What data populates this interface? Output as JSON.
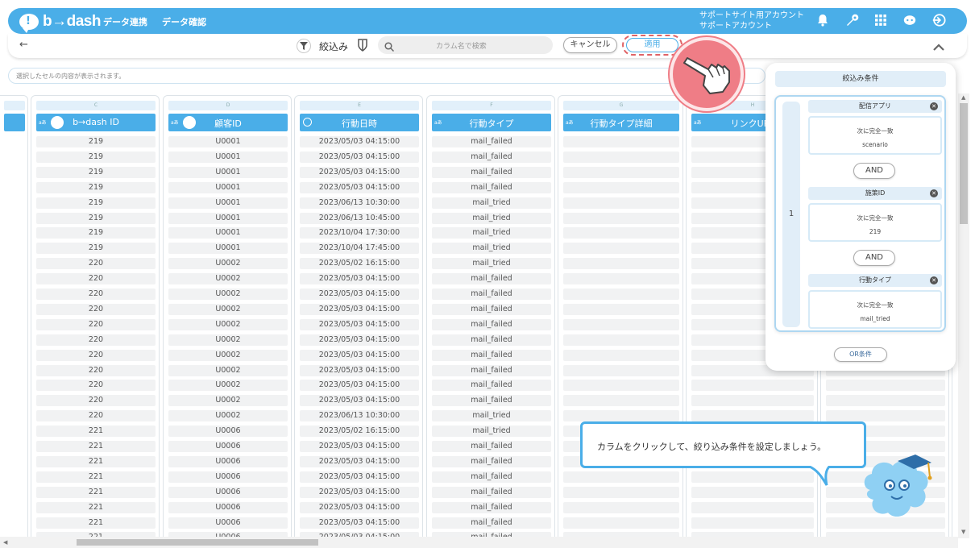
{
  "header": {
    "logo_text": "b→dash",
    "nav": [
      "データ連携",
      "データ確認"
    ],
    "account_line1": "サポートサイト用アカウント",
    "account_line2": "サポートアカウント",
    "icons": [
      "bell-icon",
      "wrench-icon",
      "grid-icon",
      "chat-icon",
      "logout-icon"
    ]
  },
  "toolbar": {
    "back_icon": "←",
    "filter_label": "絞込み",
    "search_placeholder": "カラム名で検索",
    "cancel_label": "キャンセル",
    "apply_label": "適用",
    "collapse_icon": "chevron-up-icon"
  },
  "info_bar": {
    "placeholder": "選択したセルの内容が表示されます。"
  },
  "table": {
    "columns": [
      {
        "letter": "C",
        "header": "b→dash ID",
        "type_tag": "aあ",
        "icon": "people-icon"
      },
      {
        "letter": "D",
        "header": "顧客ID",
        "type_tag": "aあ",
        "icon": "people-icon"
      },
      {
        "letter": "E",
        "header": "行動日時",
        "type_tag": "",
        "icon": "clock-icon"
      },
      {
        "letter": "F",
        "header": "行動タイプ",
        "type_tag": "aあ",
        "icon": ""
      },
      {
        "letter": "G",
        "header": "行動タイプ詳細",
        "type_tag": "aあ",
        "icon": ""
      },
      {
        "letter": "H",
        "header": "リンクURL",
        "type_tag": "aあ",
        "icon": ""
      }
    ],
    "rows": [
      [
        "219",
        "U0001",
        "2023/05/03 04:15:00",
        "mail_failed"
      ],
      [
        "219",
        "U0001",
        "2023/05/03 04:15:00",
        "mail_failed"
      ],
      [
        "219",
        "U0001",
        "2023/05/03 04:15:00",
        "mail_failed"
      ],
      [
        "219",
        "U0001",
        "2023/05/03 04:15:00",
        "mail_failed"
      ],
      [
        "219",
        "U0001",
        "2023/06/13 10:30:00",
        "mail_tried"
      ],
      [
        "219",
        "U0001",
        "2023/06/13 10:45:00",
        "mail_tried"
      ],
      [
        "219",
        "U0001",
        "2023/10/04 17:30:00",
        "mail_tried"
      ],
      [
        "219",
        "U0001",
        "2023/10/04 17:45:00",
        "mail_tried"
      ],
      [
        "220",
        "U0002",
        "2023/05/02 16:15:00",
        "mail_tried"
      ],
      [
        "220",
        "U0002",
        "2023/05/03 04:15:00",
        "mail_failed"
      ],
      [
        "220",
        "U0002",
        "2023/05/03 04:15:00",
        "mail_failed"
      ],
      [
        "220",
        "U0002",
        "2023/05/03 04:15:00",
        "mail_failed"
      ],
      [
        "220",
        "U0002",
        "2023/05/03 04:15:00",
        "mail_failed"
      ],
      [
        "220",
        "U0002",
        "2023/05/03 04:15:00",
        "mail_failed"
      ],
      [
        "220",
        "U0002",
        "2023/05/03 04:15:00",
        "mail_failed"
      ],
      [
        "220",
        "U0002",
        "2023/05/03 04:15:00",
        "mail_failed"
      ],
      [
        "220",
        "U0002",
        "2023/05/03 04:15:00",
        "mail_failed"
      ],
      [
        "220",
        "U0002",
        "2023/05/03 04:15:00",
        "mail_failed"
      ],
      [
        "220",
        "U0002",
        "2023/06/13 10:30:00",
        "mail_tried"
      ],
      [
        "221",
        "U0006",
        "2023/05/02 16:15:00",
        "mail_tried"
      ],
      [
        "221",
        "U0006",
        "2023/05/03 04:15:00",
        "mail_failed"
      ],
      [
        "221",
        "U0006",
        "2023/05/03 04:15:00",
        "mail_failed"
      ],
      [
        "221",
        "U0006",
        "2023/05/03 04:15:00",
        "mail_failed"
      ],
      [
        "221",
        "U0006",
        "2023/05/03 04:15:00",
        "mail_failed"
      ],
      [
        "221",
        "U0006",
        "2023/05/03 04:15:00",
        "mail_failed"
      ],
      [
        "221",
        "U0006",
        "2023/05/03 04:15:00",
        "mail_failed"
      ],
      [
        "221",
        "U0006",
        "2023/05/03 04:15:00",
        "mail_failed"
      ]
    ]
  },
  "filter_panel": {
    "title": "絞込み条件",
    "group_number": "1",
    "conditions": [
      {
        "column": "配信アプリ",
        "operator": "次に完全一致",
        "value": "scenario"
      },
      {
        "column": "施策ID",
        "operator": "次に完全一致",
        "value": "219"
      },
      {
        "column": "行動タイプ",
        "operator": "次に完全一致",
        "value": "mail_tried"
      }
    ],
    "and_label": "AND",
    "or_label": "OR条件"
  },
  "tooltip": {
    "text": "カラムをクリックして、絞り込み条件を設定しましょう。"
  },
  "colors": {
    "brand": "#4aaee8",
    "highlight": "#e06467",
    "cell_bg": "#f1f2f3"
  }
}
